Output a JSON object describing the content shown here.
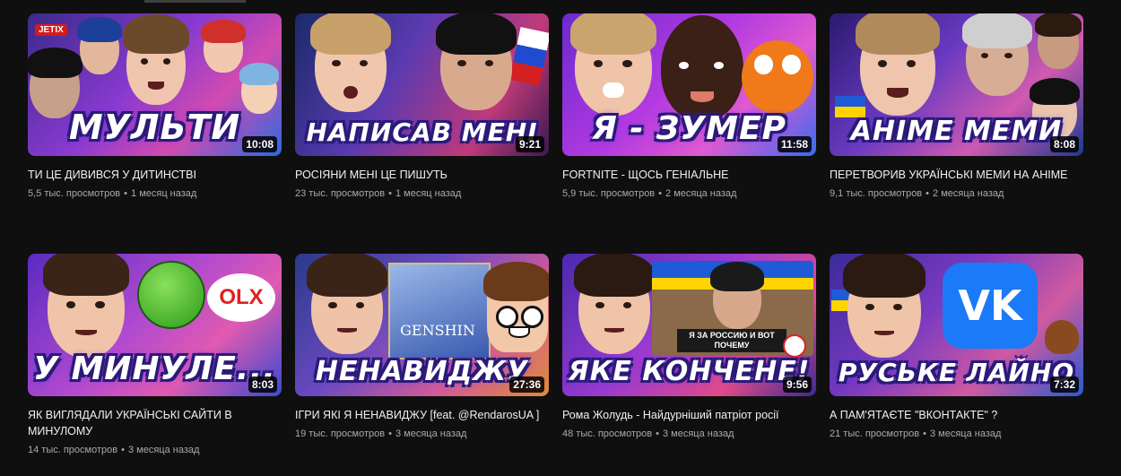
{
  "videos": [
    {
      "title": "ТИ ЦЕ ДИВИВСЯ У ДИТИНСТВІ",
      "caption": "МУЛЬТИ",
      "duration": "10:08",
      "views": "5,5 тыс. просмотров",
      "age": "1 месяц назад",
      "logo": "JETIX"
    },
    {
      "title": "РОСІЯНИ МЕНІ ЦЕ ПИШУТЬ",
      "caption": "НАПИСАВ МЕНІ",
      "duration": "9:21",
      "views": "23 тыс. просмотров",
      "age": "1 месяц назад"
    },
    {
      "title": "FORTNITE - ЩОСЬ ГЕНІАЛЬНЕ",
      "caption": "Я - ЗУМЕР",
      "duration": "11:58",
      "views": "5,9 тыс. просмотров",
      "age": "2 месяца назад"
    },
    {
      "title": "ПЕРЕТВОРИВ УКРАЇНСЬКІ МЕМИ НА АНІМЕ",
      "caption": "АНІМЕ МЕМИ",
      "duration": "8:08",
      "views": "9,1 тыс. просмотров",
      "age": "2 месяца назад"
    },
    {
      "title": "ЯК ВИГЛЯДАЛИ УКРАЇНСЬКІ САЙТИ В МИНУЛОМУ",
      "caption": "У МИНУЛЕ...",
      "duration": "8:03",
      "views": "14 тыс. просмотров",
      "age": "3 месяца назад",
      "logo": "OLX"
    },
    {
      "title": "ІГРИ ЯКІ Я НЕНАВИДЖУ [feat. @RendarosUA ]",
      "caption": "НЕНАВИДЖУ",
      "duration": "27:36",
      "views": "19 тыс. просмотров",
      "age": "3 месяца назад",
      "logo": "GENSHIN"
    },
    {
      "title": "Рома Жолудь - Найдурніший патріот росії",
      "caption": "ЯКЕ КОНЧЕНЕ!",
      "duration": "9:56",
      "views": "48 тыс. просмотров",
      "age": "3 месяца назад",
      "inset_text": "Я ЗА РОССИЮ И ВОТ ПОЧЕМУ"
    },
    {
      "title": "А ПАМ'ЯТАЄТЕ \"ВКОНТАКТЕ\" ?",
      "caption": "РУСЬКЕ ЛАЙНО",
      "duration": "7:32",
      "views": "21 тыс. просмотров",
      "age": "3 месяца назад",
      "logo": "VK"
    }
  ],
  "separator": "•"
}
